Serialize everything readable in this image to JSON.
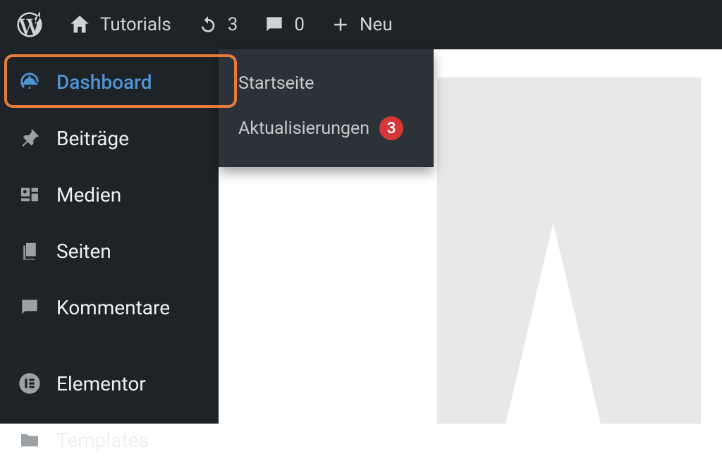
{
  "adminbar": {
    "site_name": "Tutorials",
    "updates_count": "3",
    "comments_count": "0",
    "new_label": "Neu"
  },
  "sidebar": {
    "items": [
      {
        "label": "Dashboard"
      },
      {
        "label": "Beiträge"
      },
      {
        "label": "Medien"
      },
      {
        "label": "Seiten"
      },
      {
        "label": "Kommentare"
      },
      {
        "label": "Elementor"
      },
      {
        "label": "Templates"
      }
    ]
  },
  "flyout": {
    "items": [
      {
        "label": "Startseite"
      },
      {
        "label": "Aktualisierungen",
        "badge": "3"
      }
    ]
  }
}
